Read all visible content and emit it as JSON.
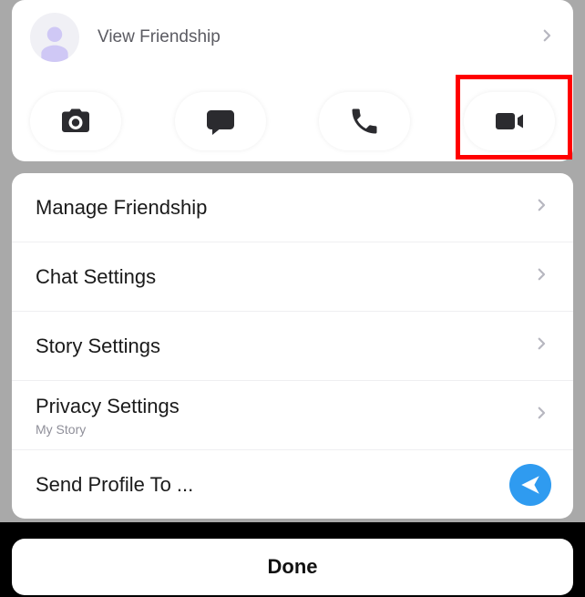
{
  "header": {
    "view_friendship": "View Friendship"
  },
  "actions": {
    "camera": "camera",
    "chat": "chat",
    "call": "call",
    "video": "video"
  },
  "settings": {
    "manage_friendship": "Manage Friendship",
    "chat_settings": "Chat Settings",
    "story_settings": "Story Settings",
    "privacy_settings": "Privacy Settings",
    "privacy_sub": "My Story",
    "send_profile": "Send Profile To ..."
  },
  "footer": {
    "done": "Done"
  },
  "highlight": "video-call-button"
}
